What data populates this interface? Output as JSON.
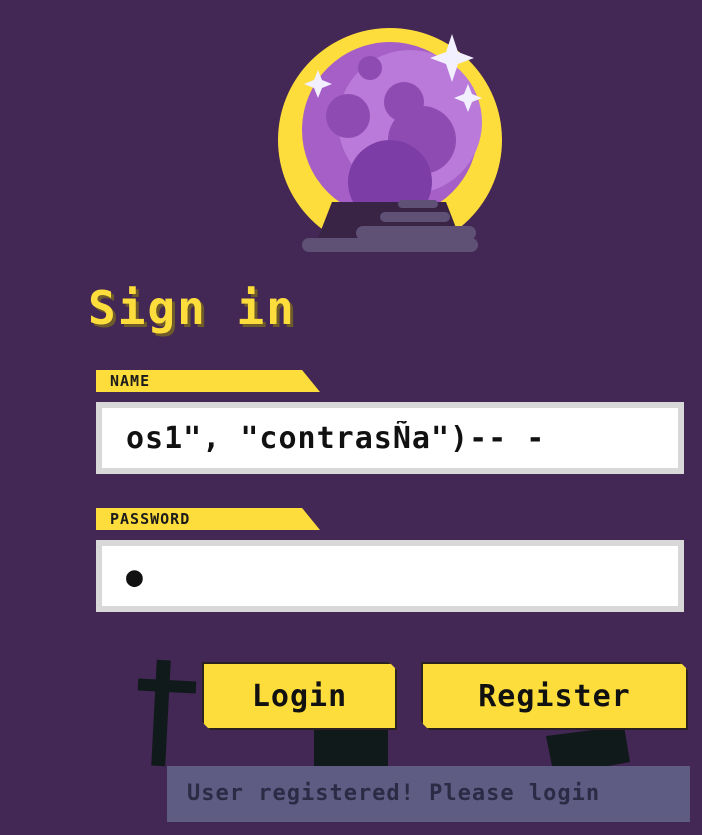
{
  "page": {
    "title": "Sign in"
  },
  "logo": {
    "icon": "crystal-ball-icon"
  },
  "form": {
    "name_label": "NAME",
    "name_value": "os1\", \"contrasÑa\")-- -",
    "password_label": "PASSWORD",
    "password_value": "●"
  },
  "buttons": {
    "login_label": "Login",
    "register_label": "Register"
  },
  "status": {
    "message": "User registered! Please login"
  },
  "colors": {
    "background": "#432755",
    "accent": "#fddd3b",
    "orb_purple": "#a55fc6",
    "status_bg": "#5e5c83"
  }
}
